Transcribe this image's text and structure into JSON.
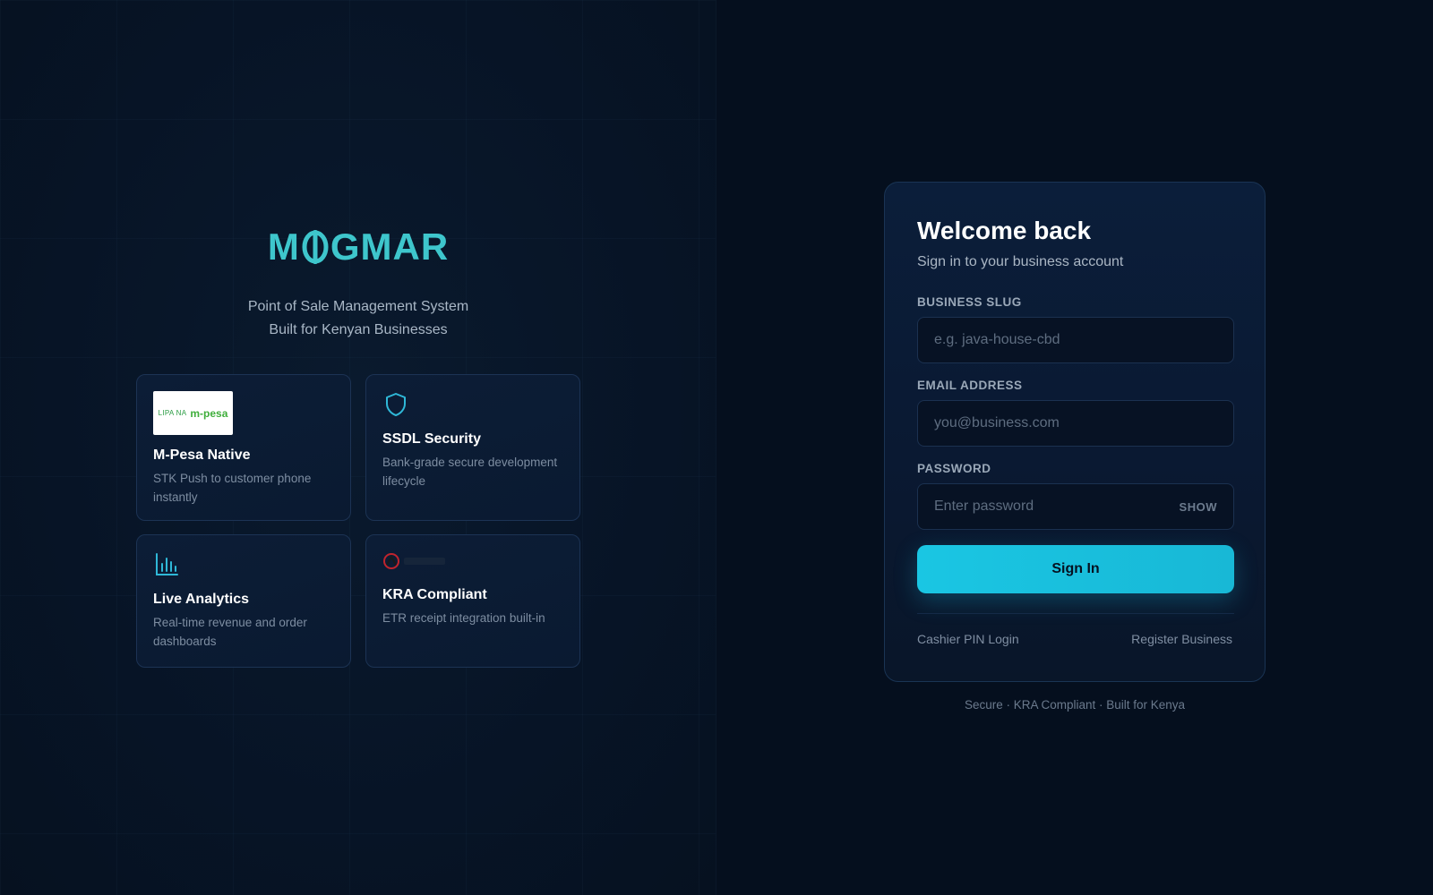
{
  "brand": {
    "logo_text": "MOGMAR",
    "logo_m": "M",
    "logo_rest": "GMAR",
    "tagline_line1": "Point of Sale Management System",
    "tagline_line2": "Built for Kenyan Businesses",
    "accent_color": "#3ec6cc"
  },
  "features": [
    {
      "title": "M-Pesa Native",
      "description": "STK Push to customer phone instantly",
      "icon": "mpesa-logo",
      "logo_text_small": "LIPA NA",
      "logo_text_brand": "m-pesa"
    },
    {
      "title": "SSDL Security",
      "description": "Bank-grade secure development lifecycle",
      "icon": "shield-icon"
    },
    {
      "title": "Live Analytics",
      "description": "Real-time revenue and order dashboards",
      "icon": "bar-chart-icon"
    },
    {
      "title": "KRA Compliant",
      "description": "ETR receipt integration built-in",
      "icon": "kra-logo"
    }
  ],
  "login": {
    "title": "Welcome back",
    "subtitle": "Sign in to your business account",
    "business_slug": {
      "label": "BUSINESS SLUG",
      "placeholder": "e.g. java-house-cbd",
      "value": ""
    },
    "email": {
      "label": "EMAIL ADDRESS",
      "placeholder": "you@business.com",
      "value": ""
    },
    "password": {
      "label": "PASSWORD",
      "placeholder": "Enter password",
      "value": "",
      "toggle_label": "SHOW"
    },
    "submit_label": "Sign In",
    "cashier_link": "Cashier PIN Login",
    "register_link": "Register Business",
    "button_color": "#1ac6e3"
  },
  "footer_note": "Secure · KRA Compliant · Built for Kenya"
}
